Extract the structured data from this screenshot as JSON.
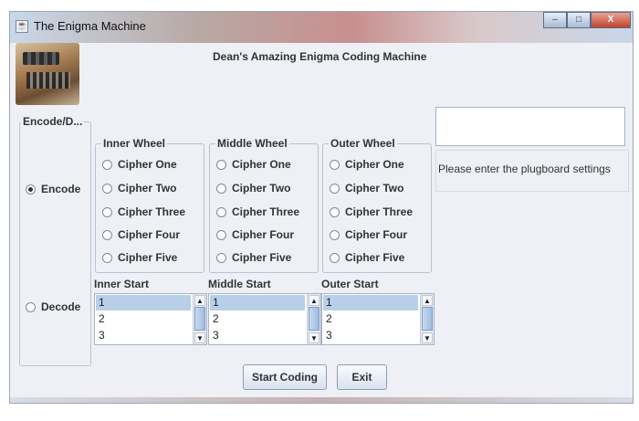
{
  "window": {
    "title": "The Enigma Machine",
    "controls": {
      "minimize": "–",
      "maximize": "□",
      "close": "X"
    }
  },
  "heading": "Dean's Amazing Enigma Coding Machine",
  "mode": {
    "legend": "Encode/D...",
    "encode_label": "Encode",
    "decode_label": "Decode",
    "selected": "Encode"
  },
  "wheels": [
    {
      "legend": "Inner Wheel",
      "options": [
        "Cipher One",
        "Cipher Two",
        "Cipher Three",
        "Cipher Four",
        "Cipher Five"
      ]
    },
    {
      "legend": "Middle Wheel",
      "options": [
        "Cipher One",
        "Cipher Two",
        "Cipher Three",
        "Cipher Four",
        "Cipher Five"
      ]
    },
    {
      "legend": "Outer Wheel",
      "options": [
        "Cipher One",
        "Cipher Two",
        "Cipher Three",
        "Cipher Four",
        "Cipher Five"
      ]
    }
  ],
  "starts": [
    {
      "label": "Inner Start",
      "items": [
        "1",
        "2",
        "3"
      ],
      "selected": "1"
    },
    {
      "label": "Middle Start",
      "items": [
        "1",
        "2",
        "3"
      ],
      "selected": "1"
    },
    {
      "label": "Outer Start",
      "items": [
        "1",
        "2",
        "3"
      ],
      "selected": "1"
    }
  ],
  "plugboard": {
    "value": "",
    "label": "Please enter the plugboard settings"
  },
  "buttons": {
    "start": "Start Coding",
    "exit": "Exit"
  },
  "icons": {
    "app": "java-cup-icon",
    "scroll_up": "▲",
    "scroll_down": "▼"
  }
}
